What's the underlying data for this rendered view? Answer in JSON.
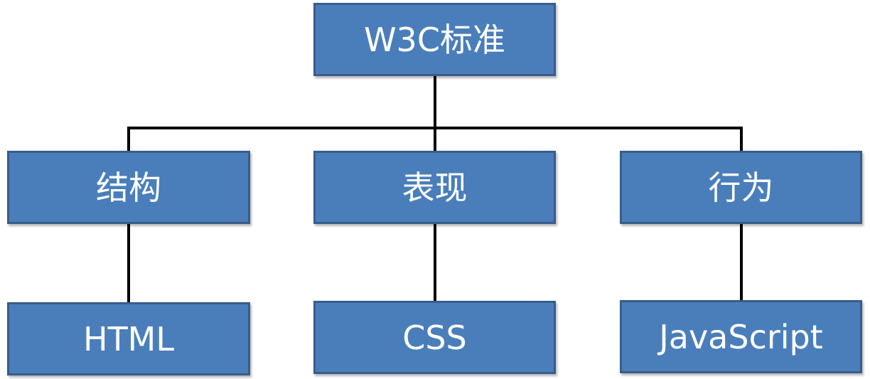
{
  "diagram": {
    "type": "tree",
    "root": {
      "label": "W3C标准"
    },
    "children": [
      {
        "label": "结构",
        "child": {
          "label": "HTML"
        }
      },
      {
        "label": "表现",
        "child": {
          "label": "CSS"
        }
      },
      {
        "label": "行为",
        "child": {
          "label": "JavaScript"
        }
      }
    ]
  },
  "colors": {
    "box_fill": "#4a7ebb",
    "box_border": "#385d8a",
    "text": "#ffffff",
    "connector": "#000000"
  }
}
